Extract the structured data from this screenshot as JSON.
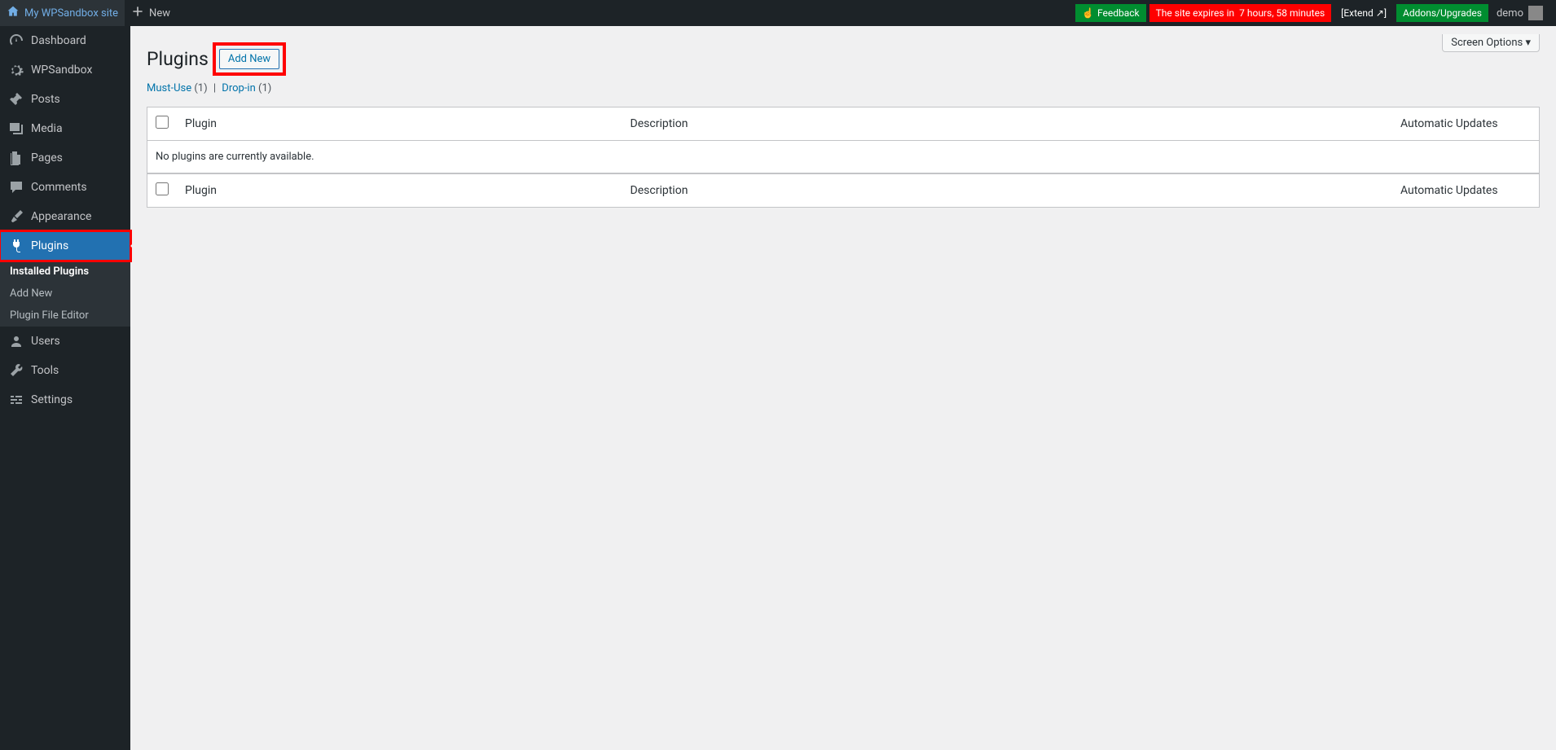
{
  "adminbar": {
    "site_name": "My WPSandbox site",
    "new_label": "New",
    "feedback": "Feedback",
    "expires_label": "The site expires in",
    "expires_time": "7 hours, 58 minutes",
    "extend": "[Extend ↗]",
    "addons": "Addons/Upgrades",
    "user": "demo"
  },
  "sidebar": {
    "items": [
      {
        "label": "Dashboard"
      },
      {
        "label": "WPSandbox"
      },
      {
        "label": "Posts"
      },
      {
        "label": "Media"
      },
      {
        "label": "Pages"
      },
      {
        "label": "Comments"
      },
      {
        "label": "Appearance"
      },
      {
        "label": "Plugins"
      },
      {
        "label": "Users"
      },
      {
        "label": "Tools"
      },
      {
        "label": "Settings"
      }
    ],
    "submenu": [
      {
        "label": "Installed Plugins"
      },
      {
        "label": "Add New"
      },
      {
        "label": "Plugin File Editor"
      }
    ]
  },
  "screen_options": "Screen Options",
  "page": {
    "title": "Plugins",
    "add_new": "Add New",
    "filters": {
      "must_use": "Must-Use",
      "must_use_count": "(1)",
      "drop_in": "Drop-in",
      "drop_in_count": "(1)"
    }
  },
  "table": {
    "col_plugin": "Plugin",
    "col_description": "Description",
    "col_auto": "Automatic Updates",
    "empty": "No plugins are currently available."
  }
}
